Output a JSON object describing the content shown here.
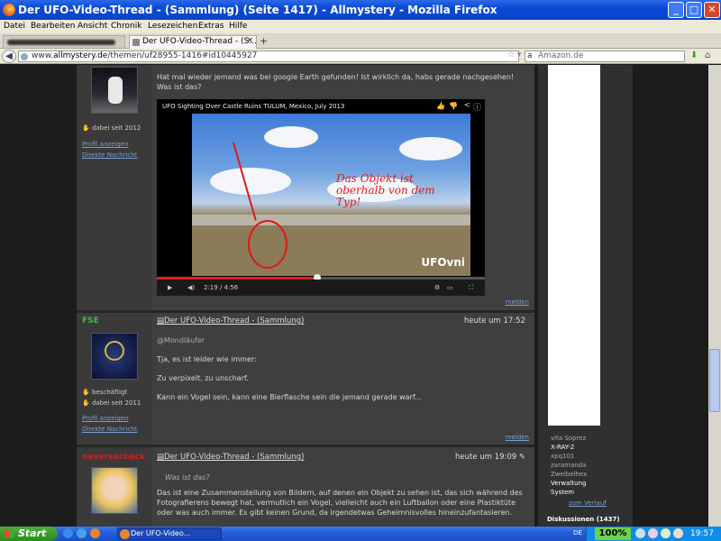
{
  "window": {
    "title": "Der UFO-Video-Thread - (Sammlung) (Seite 1417) - Allmystery - Mozilla Firefox",
    "minimize": "_",
    "maximize": "□",
    "close": "✕"
  },
  "menu": [
    "Datei",
    "Bearbeiten",
    "Ansicht",
    "Chronik",
    "Lesezeichen",
    "Extras",
    "Hilfe"
  ],
  "tabs": {
    "active_label": "Der UFO-Video-Thread - (S...",
    "close": "×",
    "new_tab": "+"
  },
  "nav": {
    "url_prefix": "www.",
    "url_domain": "allmystery.de",
    "url_path": "/themen/uf28955-1416#id10445927",
    "search_placeholder": "Amazon.de"
  },
  "posts": [
    {
      "user_since": "dabei seit 2012",
      "profile_link": "Profil anzeigen",
      "message_link": "Direkte Nachricht",
      "text_lines": [
        "Hat mal wieder jemand was bei google Earth gefunden! Ist wirklich da, habs gerade nachgesehen!",
        "Was ist das?"
      ],
      "video": {
        "title": "UFO Sighting Over Castle Ruins TULUM, Mexico, July 2013",
        "overlay_text": "Das Objekt ist oberhalb von dem Typ!",
        "logo": "UFOvni",
        "time": "2:19 / 4:56",
        "progress": 0.49
      },
      "report": "melden"
    },
    {
      "username": "FSE",
      "username_color": "#3fbf3f",
      "status": "beschäftigt",
      "user_since": "dabei seit 2011",
      "profile_link": "Profil anzeigen",
      "message_link": "Direkte Nachricht",
      "thread_title": "Der UFO-Video-Thread - (Sammlung)",
      "time": "heute um 17:52",
      "mention": "@Mondläufer",
      "text_lines": [
        "Tja, es ist leider wie immer:",
        "Zu verpixelt, zu unscharf.",
        "Kann ein Vogel sein, kann eine Bierflasche sein die jemand gerade warf..."
      ],
      "report": "melden"
    },
    {
      "username": "nevereacheck",
      "username_color": "#d02020",
      "thread_title": "Der UFO-Video-Thread - (Sammlung)",
      "time": "heute um 19:09",
      "quote": "Was ist das?",
      "text_lines": [
        "Das ist eine Zusammenstellung von Bildern, auf denen ein Objekt zu sehen ist, das sich während des",
        "Fotografierens bewegt hat, vermutlich ein Vogel, vielleicht auch ein Luftballon oder eine Plastiktüte",
        "oder was auch immer. Es gibt keinen Grund, da irgendetwas Geheimnisvolles hineinzufantasieren."
      ]
    }
  ],
  "sidebar": {
    "online_users": [
      "vita Soprez",
      "X-RAY-2",
      "xpq101",
      "zaramanda",
      "Zweibelhex",
      "Verwaltung",
      "System"
    ],
    "history_link": "zum Verlauf",
    "discussions_label": "Diskussionen (1437)"
  },
  "taskbar": {
    "start": "Start",
    "task_label": "Der UFO-Video...",
    "lang": "DE",
    "zoom": "100%",
    "clock": "19:57"
  },
  "colors": {
    "titlebar": "#0a48d6",
    "page_bg": "#1c1c1c",
    "post_bg": "#3f3f3f",
    "link": "#7a9fd0"
  }
}
